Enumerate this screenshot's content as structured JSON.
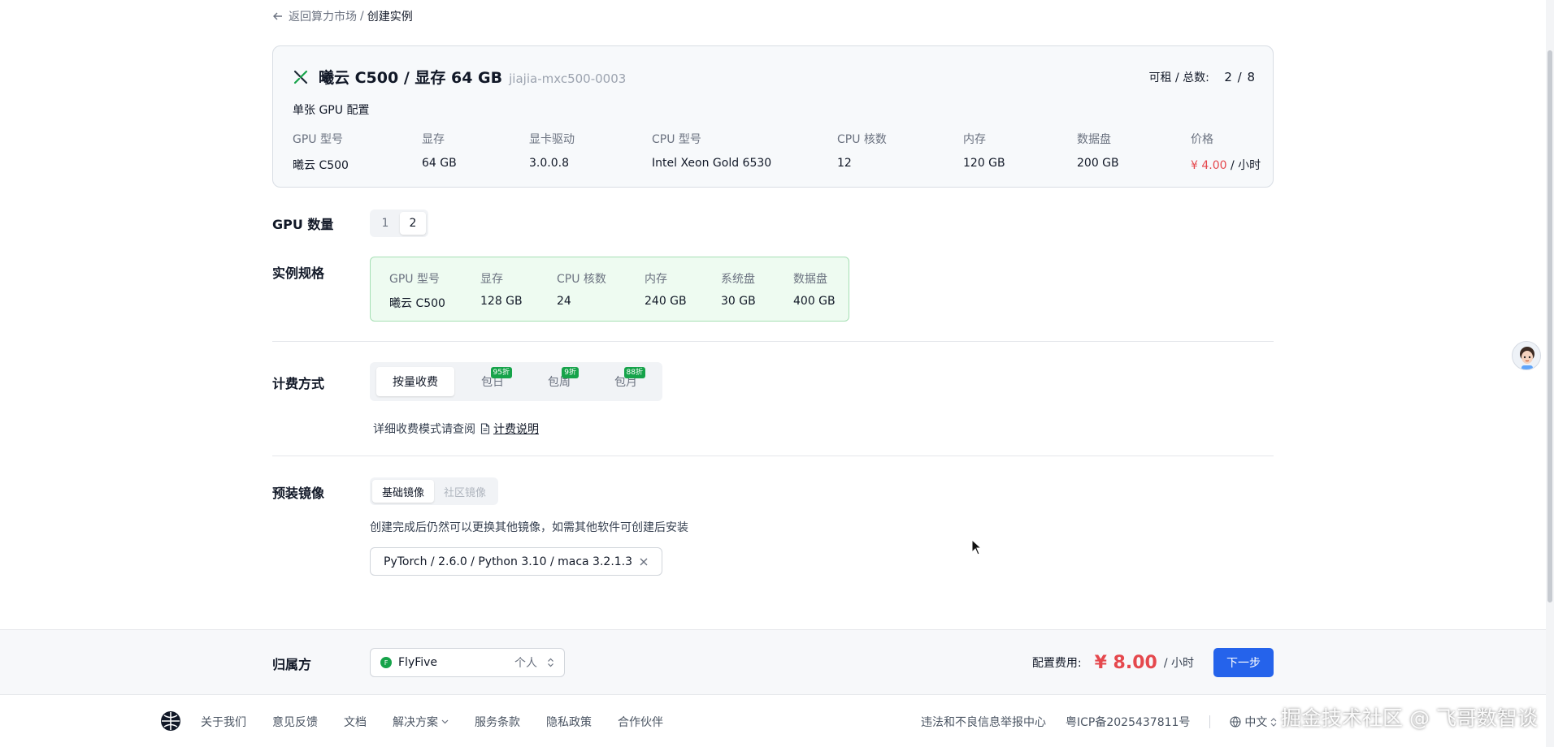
{
  "breadcrumb": {
    "back_label": "返回算力市场",
    "separator": "/",
    "current": "创建实例"
  },
  "gpu_card": {
    "title": "曦云 C500 / 显存 64 GB",
    "code": "jiajia-mxc500-0003",
    "availability_label": "可租 / 总数:",
    "availability_value": "2 / 8",
    "subtitle": "单张 GPU 配置",
    "specs": [
      {
        "label": "GPU 型号",
        "value": "曦云 C500"
      },
      {
        "label": "显存",
        "value": "64 GB"
      },
      {
        "label": "显卡驱动",
        "value": "3.0.0.8"
      },
      {
        "label": "CPU 型号",
        "value": "Intel Xeon Gold 6530"
      },
      {
        "label": "CPU 核数",
        "value": "12"
      },
      {
        "label": "内存",
        "value": "120 GB"
      },
      {
        "label": "数据盘",
        "value": "200 GB"
      },
      {
        "label": "价格",
        "price": "¥ 4.00",
        "unit": " / 小时"
      }
    ]
  },
  "gpu_count": {
    "label": "GPU 数量",
    "options": [
      "1",
      "2"
    ],
    "selected": "2"
  },
  "instance_spec": {
    "label": "实例规格",
    "specs": [
      {
        "label": "GPU 型号",
        "value": "曦云 C500"
      },
      {
        "label": "显存",
        "value": "128 GB"
      },
      {
        "label": "CPU 核数",
        "value": "24"
      },
      {
        "label": "内存",
        "value": "240 GB"
      },
      {
        "label": "系统盘",
        "value": "30 GB"
      },
      {
        "label": "数据盘",
        "value": "400 GB"
      }
    ]
  },
  "billing": {
    "label": "计费方式",
    "options": [
      {
        "label": "按量收费",
        "badge": ""
      },
      {
        "label": "包日",
        "badge": "95折"
      },
      {
        "label": "包周",
        "badge": "9折"
      },
      {
        "label": "包月",
        "badge": "88折"
      }
    ],
    "selected": "按量收费",
    "note": "详细收费模式请查阅",
    "link": "计费说明"
  },
  "image": {
    "label": "预装镜像",
    "tabs": [
      "基础镜像",
      "社区镜像"
    ],
    "selected_tab": "基础镜像",
    "note": "创建完成后仍然可以更换其他镜像，如需其他软件可创建后安装",
    "value": "PyTorch / 2.6.0 / Python 3.10 / maca 3.2.1.3"
  },
  "owner": {
    "label": "归属方",
    "org_initial": "F",
    "org_name": "FlyFive",
    "type": "个人"
  },
  "fee": {
    "label": "配置费用:",
    "amount": "¥ 8.00",
    "unit": "/ 小时",
    "next_button": "下一步"
  },
  "footer": {
    "links": [
      "关于我们",
      "意见反馈",
      "文档",
      "解决方案",
      "服务条款",
      "隐私政策",
      "合作伙伴"
    ],
    "report": "违法和不良信息举报中心",
    "icp": "粤ICP备2025437811号",
    "language": "中文"
  },
  "watermark": "掘金技术社区 @ 飞哥数智谈",
  "colors": {
    "primary": "#2563eb",
    "price": "#e5484d",
    "success": "#16a34a",
    "spec_bg": "#eefbf1"
  }
}
